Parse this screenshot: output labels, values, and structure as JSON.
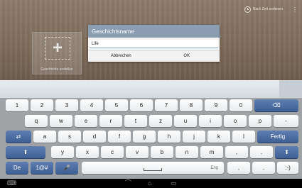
{
  "app": {
    "topbar_label": "Nach Zeit sortieren",
    "more_label": "⋮",
    "tile_caption": "Geschichte erstellen"
  },
  "dialog": {
    "title": "Geschichtsname",
    "input_value": "Life",
    "cancel_label": "Abbrechen",
    "ok_label": "OK"
  },
  "keyboard": {
    "row1": [
      "1",
      "2",
      "3",
      "4",
      "5",
      "6",
      "7",
      "8",
      "9",
      "0"
    ],
    "backspace": "⌫",
    "row2": [
      "q",
      "w",
      "e",
      "r",
      "t",
      "z",
      "u",
      "i",
      "o",
      "p",
      "-"
    ],
    "tab": "⇄",
    "row3": [
      "a",
      "s",
      "d",
      "f",
      "g",
      "h",
      "j",
      "k",
      "l"
    ],
    "done": "Fertig",
    "shift": "⬆",
    "row4": [
      "y",
      "x",
      "c",
      "v",
      "b",
      "n",
      "m",
      ",",
      "."
    ],
    "lang": "De",
    "symbols": "1@#",
    "mic": "🎤",
    "space_hint": "Eng",
    "bottom_comma": ",",
    "bottom_period": ".",
    "smiley": ":-)"
  },
  "navbar": {
    "back": "⌒",
    "home": "⌂",
    "recent": "▭",
    "keyboard_toggle": "⌨"
  }
}
